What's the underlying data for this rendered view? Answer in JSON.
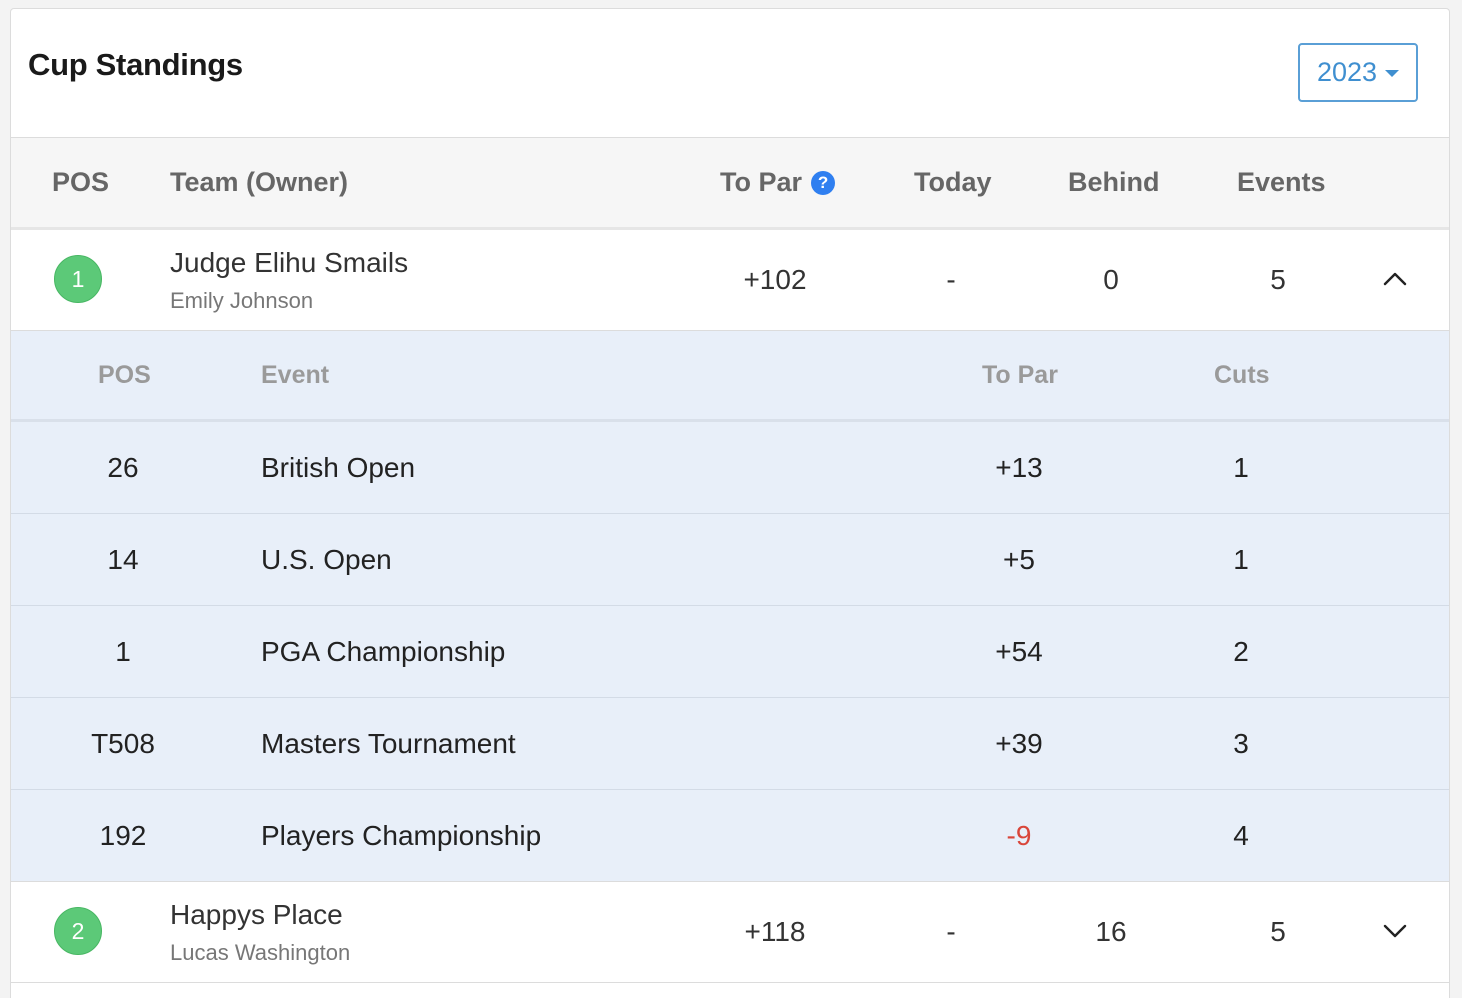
{
  "header": {
    "title": "Cup Standings",
    "year_selected": "2023"
  },
  "columns": {
    "pos": "POS",
    "team": "Team (Owner)",
    "to_par": "To Par",
    "today": "Today",
    "behind": "Behind",
    "events": "Events",
    "help_icon_glyph": "?"
  },
  "teams": [
    {
      "rank": "1",
      "name": "Judge Elihu Smails",
      "owner": "Emily Johnson",
      "to_par": "+102",
      "today": "-",
      "behind": "0",
      "events": "5",
      "expanded": true,
      "toggle_icon": "chevron-up-icon"
    },
    {
      "rank": "2",
      "name": "Happys Place",
      "owner": "Lucas Washington",
      "to_par": "+118",
      "today": "-",
      "behind": "16",
      "events": "5",
      "expanded": false,
      "toggle_icon": "chevron-down-icon"
    }
  ],
  "event_columns": {
    "pos": "POS",
    "event": "Event",
    "to_par": "To Par",
    "cuts": "Cuts"
  },
  "events": [
    {
      "pos": "26",
      "event": "British Open",
      "to_par": "+13",
      "cuts": "1"
    },
    {
      "pos": "14",
      "event": "U.S. Open",
      "to_par": "+5",
      "cuts": "1"
    },
    {
      "pos": "1",
      "event": "PGA Championship",
      "to_par": "+54",
      "cuts": "2"
    },
    {
      "pos": "T508",
      "event": "Masters Tournament",
      "to_par": "+39",
      "cuts": "3"
    },
    {
      "pos": "192",
      "event": "Players Championship",
      "to_par": "-9",
      "cuts": "4"
    }
  ],
  "colors": {
    "badge_green": "#5cc978",
    "accent_blue": "#3f8fd0",
    "expanded_bg": "#e8eff9",
    "negative_red": "#d9463a"
  }
}
